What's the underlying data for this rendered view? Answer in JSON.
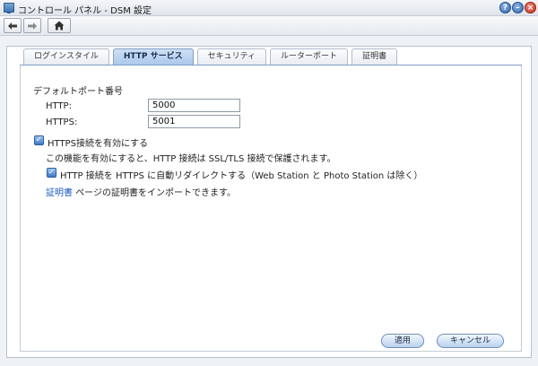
{
  "window": {
    "title": "コントロール パネル - DSM 設定",
    "help_glyph": "?",
    "minimize_glyph": "–",
    "close_glyph": "×"
  },
  "toolbar": {
    "back_icon": "left-arrow-icon",
    "forward_icon": "right-arrow-icon",
    "home_icon": "home-icon"
  },
  "tabs": [
    {
      "label": "ログインスタイル",
      "active": false
    },
    {
      "label": "HTTP サービス",
      "active": true
    },
    {
      "label": "セキュリティ",
      "active": false
    },
    {
      "label": "ルーターポート",
      "active": false
    },
    {
      "label": "証明書",
      "active": false
    }
  ],
  "form": {
    "section_title": "デフォルトポート番号",
    "http_label": "HTTP:",
    "http_value": "5000",
    "https_label": "HTTPS:",
    "https_value": "5001",
    "enable_https_label": "HTTPS接続を有効にする",
    "enable_https_checked": true,
    "description": "この機能を有効にすると、HTTP 接続は SSL/TLS 接続で保護されます。",
    "redirect_label": "HTTP 接続を HTTPS に自動リダイレクトする（Web Station と Photo Station は除く）",
    "redirect_checked": true,
    "cert_link": "証明書",
    "cert_text": " ページの証明書をインポートできます。"
  },
  "buttons": {
    "apply": "適用",
    "cancel": "キャンセル"
  },
  "colors": {
    "accent": "#3d79c8",
    "link": "#1e58c2",
    "active_tab": "#a9c6ea"
  }
}
